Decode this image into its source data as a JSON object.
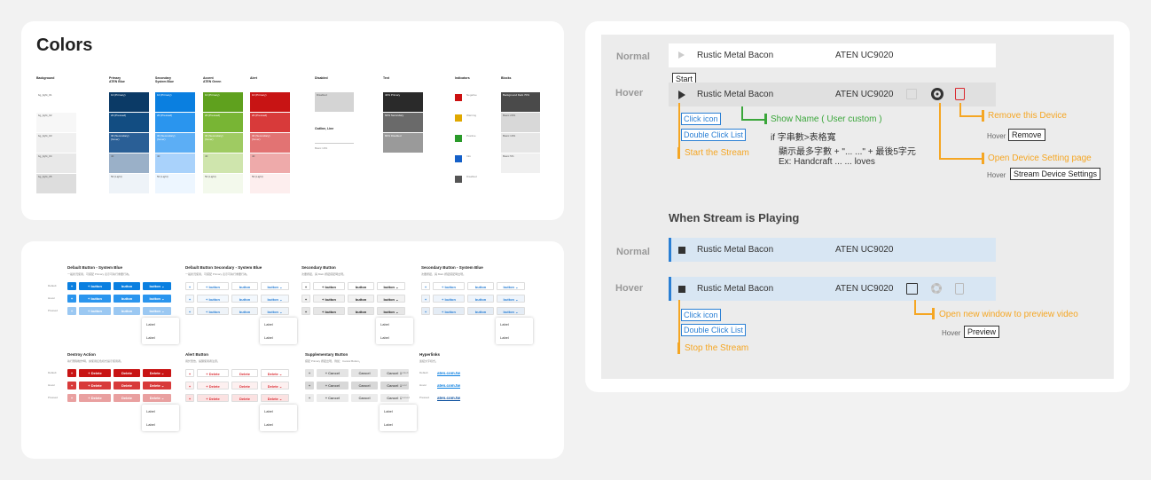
{
  "colors_card": {
    "title": "Colors",
    "columns": [
      {
        "label": "Background",
        "swatches": [
          {
            "color": "#ffffff",
            "text": "bg_light_01"
          },
          {
            "color": "#f7f7f7",
            "text": "bg_light_02"
          },
          {
            "color": "#f0f0f0",
            "text": "bg_light_03"
          },
          {
            "color": "#e8e8e8",
            "text": "bg_light_04"
          },
          {
            "color": "#dddddd",
            "text": "bg_light_05"
          }
        ]
      },
      {
        "label": "Primary\nATEN Blue",
        "swatches": [
          {
            "color": "#0b3a66",
            "text": "10 (Primary)"
          },
          {
            "color": "#124d82",
            "text": "20 (Pressed)"
          },
          {
            "color": "#2a5f96",
            "text": "30 (Secondary)\n(hover)"
          },
          {
            "color": "#9ab0c8",
            "text": "40"
          },
          {
            "color": "#eef3f8",
            "text": "50 (Light)"
          }
        ]
      },
      {
        "label": "Secondary\nSystem Blue",
        "swatches": [
          {
            "color": "#0a7fe0",
            "text": "10 (Primary)"
          },
          {
            "color": "#2a95ee",
            "text": "20 (Pressed)"
          },
          {
            "color": "#5caef5",
            "text": "30 (Secondary)\n(hover)"
          },
          {
            "color": "#a9d2fb",
            "text": "40"
          },
          {
            "color": "#edf6ff",
            "text": "50 (Light)"
          }
        ]
      },
      {
        "label": "Accent\nATEN Green",
        "swatches": [
          {
            "color": "#5fa11e",
            "text": "10 (Primary)"
          },
          {
            "color": "#78b534",
            "text": "20 (Pressed)"
          },
          {
            "color": "#9fcb62",
            "text": "30 (Secondary)\n(hover)"
          },
          {
            "color": "#cfe5ad",
            "text": "40"
          },
          {
            "color": "#f3f9ec",
            "text": "50 (Light)"
          }
        ]
      },
      {
        "label": "Alert",
        "swatches": [
          {
            "color": "#c81414",
            "text": "10 (Primary)"
          },
          {
            "color": "#d83a3a",
            "text": "20 (Pressed)"
          },
          {
            "color": "#e27373",
            "text": "30 (Secondary)\n(hover)"
          },
          {
            "color": "#eeaaaa",
            "text": "40"
          },
          {
            "color": "#fdeeee",
            "text": "50 (Light)"
          }
        ]
      }
    ],
    "disabled": {
      "label": "Disabled",
      "text1": "Disabled",
      "outline": "Outline, Line",
      "text2": "Basic 10%"
    },
    "text_col": {
      "label": "Text",
      "items": [
        {
          "color": "#2a2a2a",
          "text": "40% Primary"
        },
        {
          "color": "#6a6a6a",
          "text": "60% Secondary"
        },
        {
          "color": "#9a9a9a",
          "text": "80% Disabled"
        }
      ]
    },
    "indicators": {
      "label": "Indicators",
      "items": [
        {
          "color": "#cc1111",
          "text": "Negative"
        },
        {
          "color": "#e0a800",
          "text": "Warning"
        },
        {
          "color": "#2a9a2a",
          "text": "Positive"
        },
        {
          "color": "#1560c8",
          "text": "Info"
        },
        {
          "color": "#555555",
          "text": "Disabled"
        }
      ]
    },
    "blocks": {
      "label": "Blocks",
      "items": [
        {
          "color": "#4a4a4a",
          "text": "Background Dark 70%"
        },
        {
          "color": "#d8d8d8",
          "text": "Basic 20%"
        },
        {
          "color": "#e6e6e6",
          "text": "Basic 10%"
        },
        {
          "color": "#f0f0f0",
          "text": "Basic 5%"
        }
      ]
    }
  },
  "buttons_card": {
    "sections": [
      {
        "title": "Default Button - System Blue",
        "desc": "一般狀況使用，可搭配 Primary 表示可執行重要行為。",
        "rows": [
          "Default",
          "Hover",
          "Pressed"
        ],
        "label": "button",
        "kind": "blue"
      },
      {
        "title": "Default Button Secondary - System Blue",
        "desc": "一般狀況使用，可搭配 Primary 表示可執行重要行為。",
        "label": "button",
        "kind": "outline"
      },
      {
        "title": "Secondary Button",
        "desc": "次要按鈕，與 Main 按鈕搭配時出現。",
        "label": "button",
        "kind": "plain"
      },
      {
        "title": "Secondary Button - System Blue",
        "desc": "次要按鈕，與 Main 按鈕搭配時出現。",
        "label": "button",
        "kind": "blueplain"
      },
      {
        "title": "Destroy Action",
        "desc": "執行刪除動作時，請使用紅色樣式提示使用者。",
        "rows": [
          "Default",
          "Hover",
          "Pressed"
        ],
        "label": "Delete",
        "kind": "red"
      },
      {
        "title": "Alert Button",
        "desc": "用於警告，提醒使用者注意。",
        "label": "Delete",
        "kind": "redoutline"
      },
      {
        "title": "Supplementary Button",
        "desc": "搭配 Primary 按鈕出現，例如：Cancel Button。",
        "label": "Cancel",
        "kind": "gray"
      },
      {
        "title": "Hyperlinks",
        "desc": "連結文字樣式。",
        "rows": [
          "Default",
          "Hover",
          "Pressed"
        ],
        "label": "aten.com.tw",
        "kind": "link"
      }
    ],
    "dropdown_items": [
      "Label",
      "Label"
    ]
  },
  "spec_card": {
    "normal_label": "Normal",
    "hover_label": "Hover",
    "device_name": "Rustic Metal Bacon",
    "model": "ATEN UC9020",
    "start_tip": "Start",
    "click_icon": "Click icon",
    "double_click": "Double Click List",
    "start_stream": "Start the Stream",
    "show_name": "Show Name ( User custom )",
    "note1": "if 字串數>表格寬",
    "note2": "顯示最多字數 + \"... ...\" + 最後5字元",
    "note3": "Ex: Handcraft ... ... loves",
    "remove_device": "Remove this Device",
    "hover_word": "Hover",
    "remove_tip": "Remove",
    "open_settings": "Open Device Setting page",
    "settings_tip": "Stream Device Settings",
    "playing_title": "When Stream is Playing",
    "stop_stream": "Stop the Stream",
    "open_preview": "Open new window to preview video",
    "preview_tip": "Preview"
  },
  "accent": {
    "green": "#3aa63a",
    "orange": "#f5a623",
    "blue": "#2a7fd4",
    "red": "#d9272e",
    "playing_bg": "#d8e6f3",
    "playing_bar": "#2a7fd4"
  }
}
